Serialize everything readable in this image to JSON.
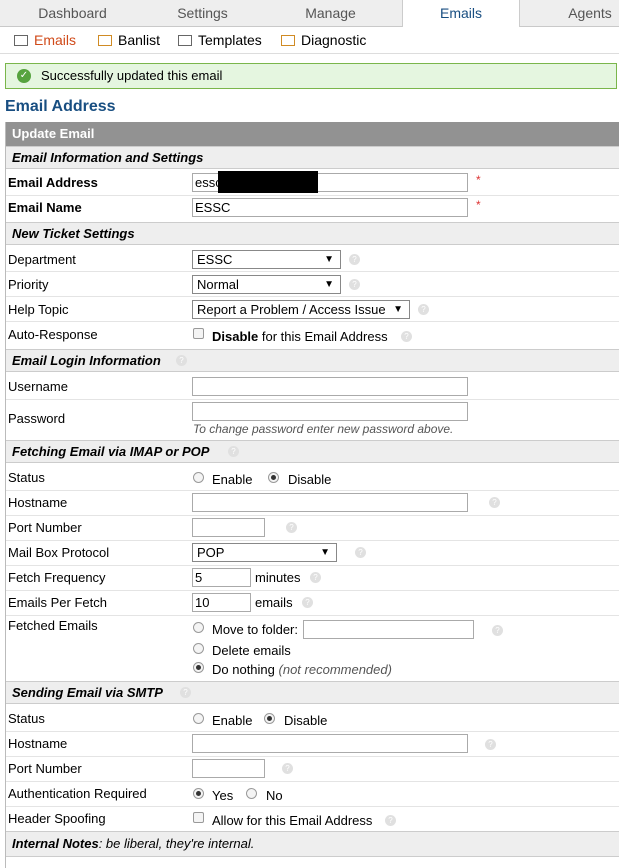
{
  "tabs": [
    {
      "label": "Dashboard"
    },
    {
      "label": "Settings"
    },
    {
      "label": "Manage"
    },
    {
      "label": "Emails"
    },
    {
      "label": "Agents"
    }
  ],
  "subnav": [
    {
      "label": "Emails"
    },
    {
      "label": "Banlist"
    },
    {
      "label": "Templates"
    },
    {
      "label": "Diagnostic"
    }
  ],
  "alert": {
    "message": "Successfully updated this email"
  },
  "page_title": "Email Address",
  "form_header": "Update Email",
  "sections": {
    "info": "Email Information and Settings",
    "ticket": "New Ticket Settings",
    "login": "Email Login Information",
    "fetch": "Fetching Email via IMAP or POP",
    "smtp": "Sending Email via SMTP",
    "notes": "Internal Notes",
    "notes_hint": ": be liberal, they're internal."
  },
  "info": {
    "email_label": "Email Address",
    "email_value": "essc",
    "name_label": "Email Name",
    "name_value": "ESSC",
    "required_mark": "*"
  },
  "ticket": {
    "department_label": "Department",
    "department_value": "ESSC",
    "priority_label": "Priority",
    "priority_value": "Normal",
    "topic_label": "Help Topic",
    "topic_value": "Report a Problem / Access Issue",
    "autoresp_label": "Auto-Response",
    "autoresp_bold": "Disable",
    "autoresp_text": " for this Email Address"
  },
  "login": {
    "username_label": "Username",
    "password_label": "Password",
    "password_hint": "To change password enter new password above."
  },
  "fetch": {
    "status_label": "Status",
    "enable": "Enable",
    "disable": "Disable",
    "hostname_label": "Hostname",
    "port_label": "Port Number",
    "protocol_label": "Mail Box Protocol",
    "protocol_value": "POP",
    "frequency_label": "Fetch Frequency",
    "frequency_value": "5",
    "frequency_unit": "minutes",
    "per_fetch_label": "Emails Per Fetch",
    "per_fetch_value": "10",
    "per_fetch_unit": "emails",
    "fetched_label": "Fetched Emails",
    "move_label": "Move to folder:",
    "delete_label": "Delete emails",
    "nothing_label": "Do nothing",
    "nothing_note": "(not recommended)"
  },
  "smtp": {
    "status_label": "Status",
    "enable": "Enable",
    "disable": "Disable",
    "hostname_label": "Hostname",
    "port_label": "Port Number",
    "auth_label": "Authentication Required",
    "yes": "Yes",
    "no": "No",
    "spoof_label": "Header Spoofing",
    "spoof_text": "Allow for this Email Address"
  },
  "icons": {
    "help": "question-icon",
    "ok": "check-circle-icon"
  },
  "colors": {
    "accent": "#184e81",
    "active_sub": "#d04a19",
    "success_bg": "#e5f6e0"
  }
}
